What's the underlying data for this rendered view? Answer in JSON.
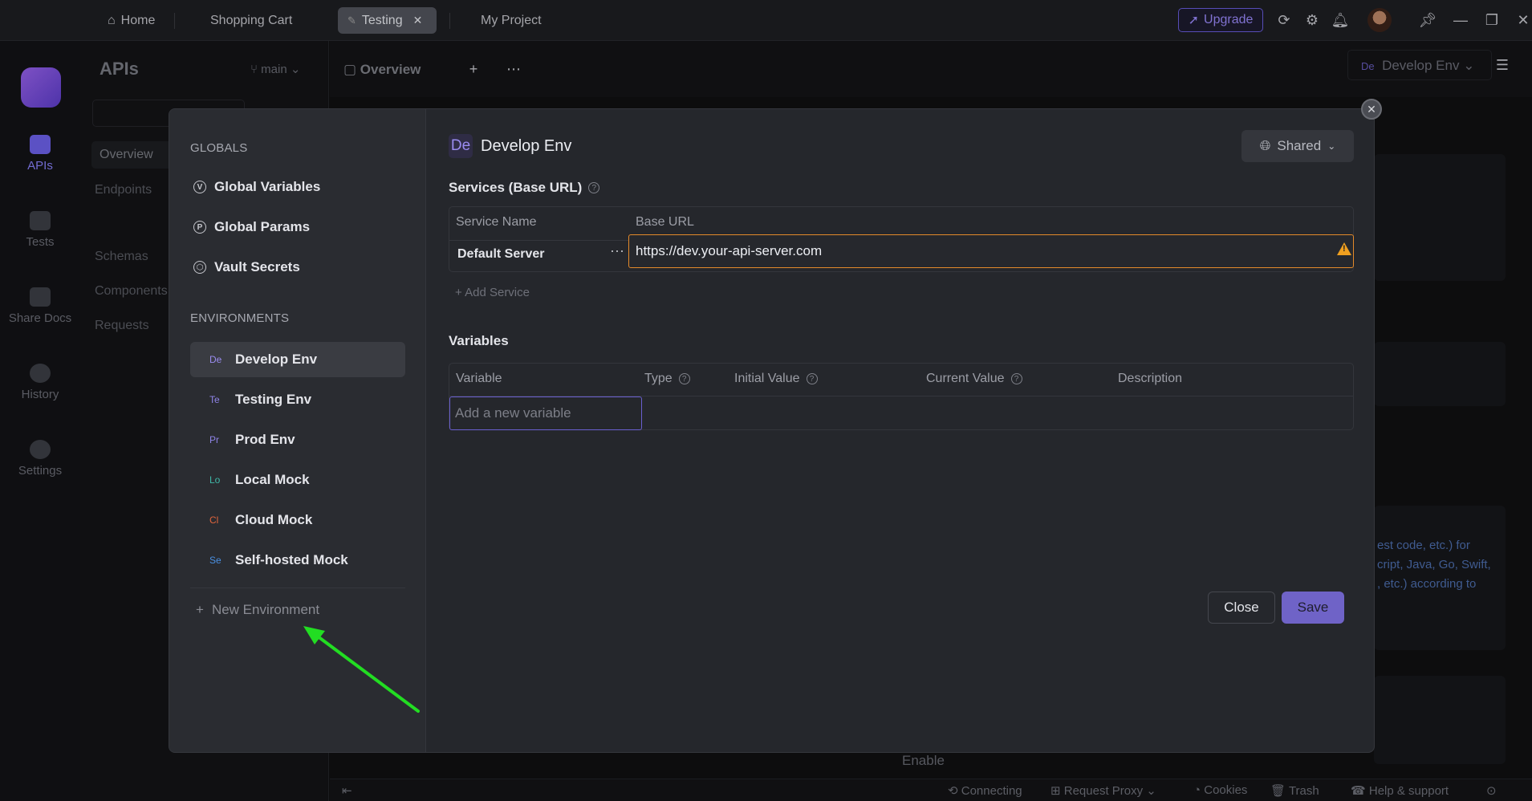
{
  "titlebar": {
    "tabs": [
      {
        "label": "Home"
      },
      {
        "label": "Shopping Cart"
      },
      {
        "label": "Testing"
      },
      {
        "label": "My Project"
      }
    ],
    "upgrade_label": "Upgrade"
  },
  "rail": {
    "items": [
      {
        "label": "APIs"
      },
      {
        "label": "Tests"
      },
      {
        "label": "Share Docs"
      },
      {
        "label": "History"
      },
      {
        "label": "Settings"
      }
    ]
  },
  "apis_panel": {
    "title": "APIs",
    "branch": "main",
    "items": [
      "Overview",
      "Endpoints",
      "Schemas",
      "Components",
      "Requests"
    ]
  },
  "main": {
    "tab_label": "Overview",
    "env_selector": "Develop Env",
    "bg_text_lines": [
      "est code, etc.) for",
      "cript, Java, Go, Swift,",
      ", etc.) according to"
    ],
    "enable_label": "Enable"
  },
  "statusbar": {
    "connecting": "Connecting",
    "request_proxy": "Request Proxy",
    "cookies": "Cookies",
    "trash": "Trash",
    "help": "Help & support"
  },
  "modal": {
    "globals_heading": "GLOBALS",
    "globals": [
      {
        "label": "Global Variables",
        "icon": "V"
      },
      {
        "label": "Global Params",
        "icon": "P"
      },
      {
        "label": "Vault Secrets",
        "icon": "⬡"
      }
    ],
    "environments_heading": "ENVIRONMENTS",
    "environments": [
      {
        "badge": "De",
        "label": "Develop Env",
        "color": "#9a8cf0"
      },
      {
        "badge": "Te",
        "label": "Testing Env",
        "color": "#8f84e8"
      },
      {
        "badge": "Pr",
        "label": "Prod Env",
        "color": "#8f84e8"
      },
      {
        "badge": "Lo",
        "label": "Local Mock",
        "color": "#3fb8a8"
      },
      {
        "badge": "Cl",
        "label": "Cloud Mock",
        "color": "#e0643c"
      },
      {
        "badge": "Se",
        "label": "Self-hosted Mock",
        "color": "#4a90e2"
      }
    ],
    "new_environment": "New Environment",
    "env_badge": "De",
    "env_title": "Develop Env",
    "shared_label": "Shared",
    "services_label": "Services (Base URL)",
    "services_columns": [
      "Service Name",
      "Base URL"
    ],
    "service_name": "Default Server",
    "base_url": "https://dev.your-api-server.com",
    "add_service": "Add Service",
    "variables_label": "Variables",
    "variables_columns": [
      "Variable",
      "Type",
      "Initial Value",
      "Current Value",
      "Description"
    ],
    "variable_placeholder": "Add a new variable",
    "close_label": "Close",
    "save_label": "Save"
  }
}
